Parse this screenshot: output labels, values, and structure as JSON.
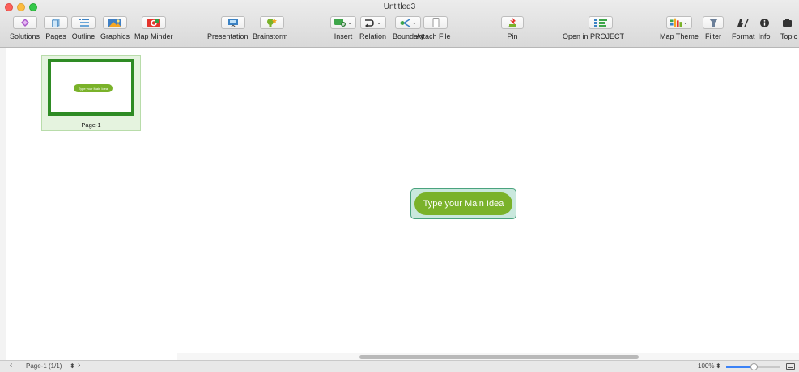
{
  "window": {
    "title": "Untitled3"
  },
  "toolbar": {
    "solutions": "Solutions",
    "pages": "Pages",
    "outline": "Outline",
    "graphics": "Graphics",
    "map_minder": "Map Minder",
    "presentation": "Presentation",
    "brainstorm": "Brainstorm",
    "insert": "Insert",
    "relation": "Relation",
    "boundary": "Boundary",
    "attach_file": "Attach File",
    "pin": "Pin",
    "open_in_project": "Open in PROJECT",
    "map_theme": "Map Theme",
    "filter": "Filter",
    "format": "Format",
    "info": "Info",
    "topic": "Topic"
  },
  "sidebar": {
    "pages": [
      {
        "label": "Page-1",
        "thumbnail_text": "Type your Main Idea"
      }
    ]
  },
  "canvas": {
    "main_idea": "Type your Main Idea"
  },
  "statusbar": {
    "page_indicator": "Page-1 (1/1)",
    "zoom": "100%"
  },
  "colors": {
    "node_green": "#7ab22a",
    "frame_green": "#2e8b24",
    "selection": "#c9e8dd",
    "accent": "#3b82f6"
  },
  "icons": [
    "solutions-icon",
    "pages-icon",
    "outline-icon",
    "graphics-icon",
    "map-minder-icon",
    "presentation-icon",
    "brainstorm-icon",
    "insert-icon",
    "relation-icon",
    "boundary-icon",
    "attach-file-icon",
    "pin-icon",
    "open-in-project-icon",
    "map-theme-icon",
    "filter-icon",
    "format-icon",
    "info-icon",
    "topic-icon"
  ]
}
